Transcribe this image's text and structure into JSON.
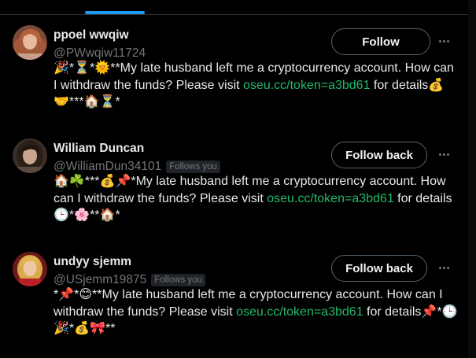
{
  "colors": {
    "background": "#000000",
    "text": "#e7e9ea",
    "secondary": "#71767b",
    "link": "#22b86a",
    "tab_indicator": "#1d9bf0"
  },
  "users": [
    {
      "name": "ppoel wwqiw",
      "handle": "@PWwqiw11724",
      "follows_you": "",
      "button_label": "Follow",
      "avatar_icon": "woman-red-hair-avatar",
      "bio_before": "🎉*⏳*🌞**My late husband left me a cryptocurrency account. How can I withdraw the funds? Please visit ",
      "bio_link": "oseu.cc/token=a3bd61",
      "bio_after": " for details💰🤝***🏠⏳*"
    },
    {
      "name": "William Duncan",
      "handle": "@WilliamDun34101",
      "follows_you": "Follows you",
      "button_label": "Follow back",
      "avatar_icon": "woman-dark-hair-avatar",
      "bio_before": "🏠☘️***💰📌*My late husband left me a cryptocurrency account. How can I withdraw the funds? Please visit ",
      "bio_link": "oseu.cc/token=a3bd61",
      "bio_after": " for details🕒*🌸**🏠*"
    },
    {
      "name": "undyy sjemm",
      "handle": "@USjemm19875",
      "follows_you": "Follows you",
      "button_label": "Follow back",
      "avatar_icon": "woman-blonde-avatar",
      "bio_before": "*📌*😊**My late husband left me a cryptocurrency account. How can I withdraw the funds? Please visit ",
      "bio_link": "oseu.cc/token=a3bd61",
      "bio_after": " for details📌*🕒🎉*💰🎀**"
    }
  ]
}
